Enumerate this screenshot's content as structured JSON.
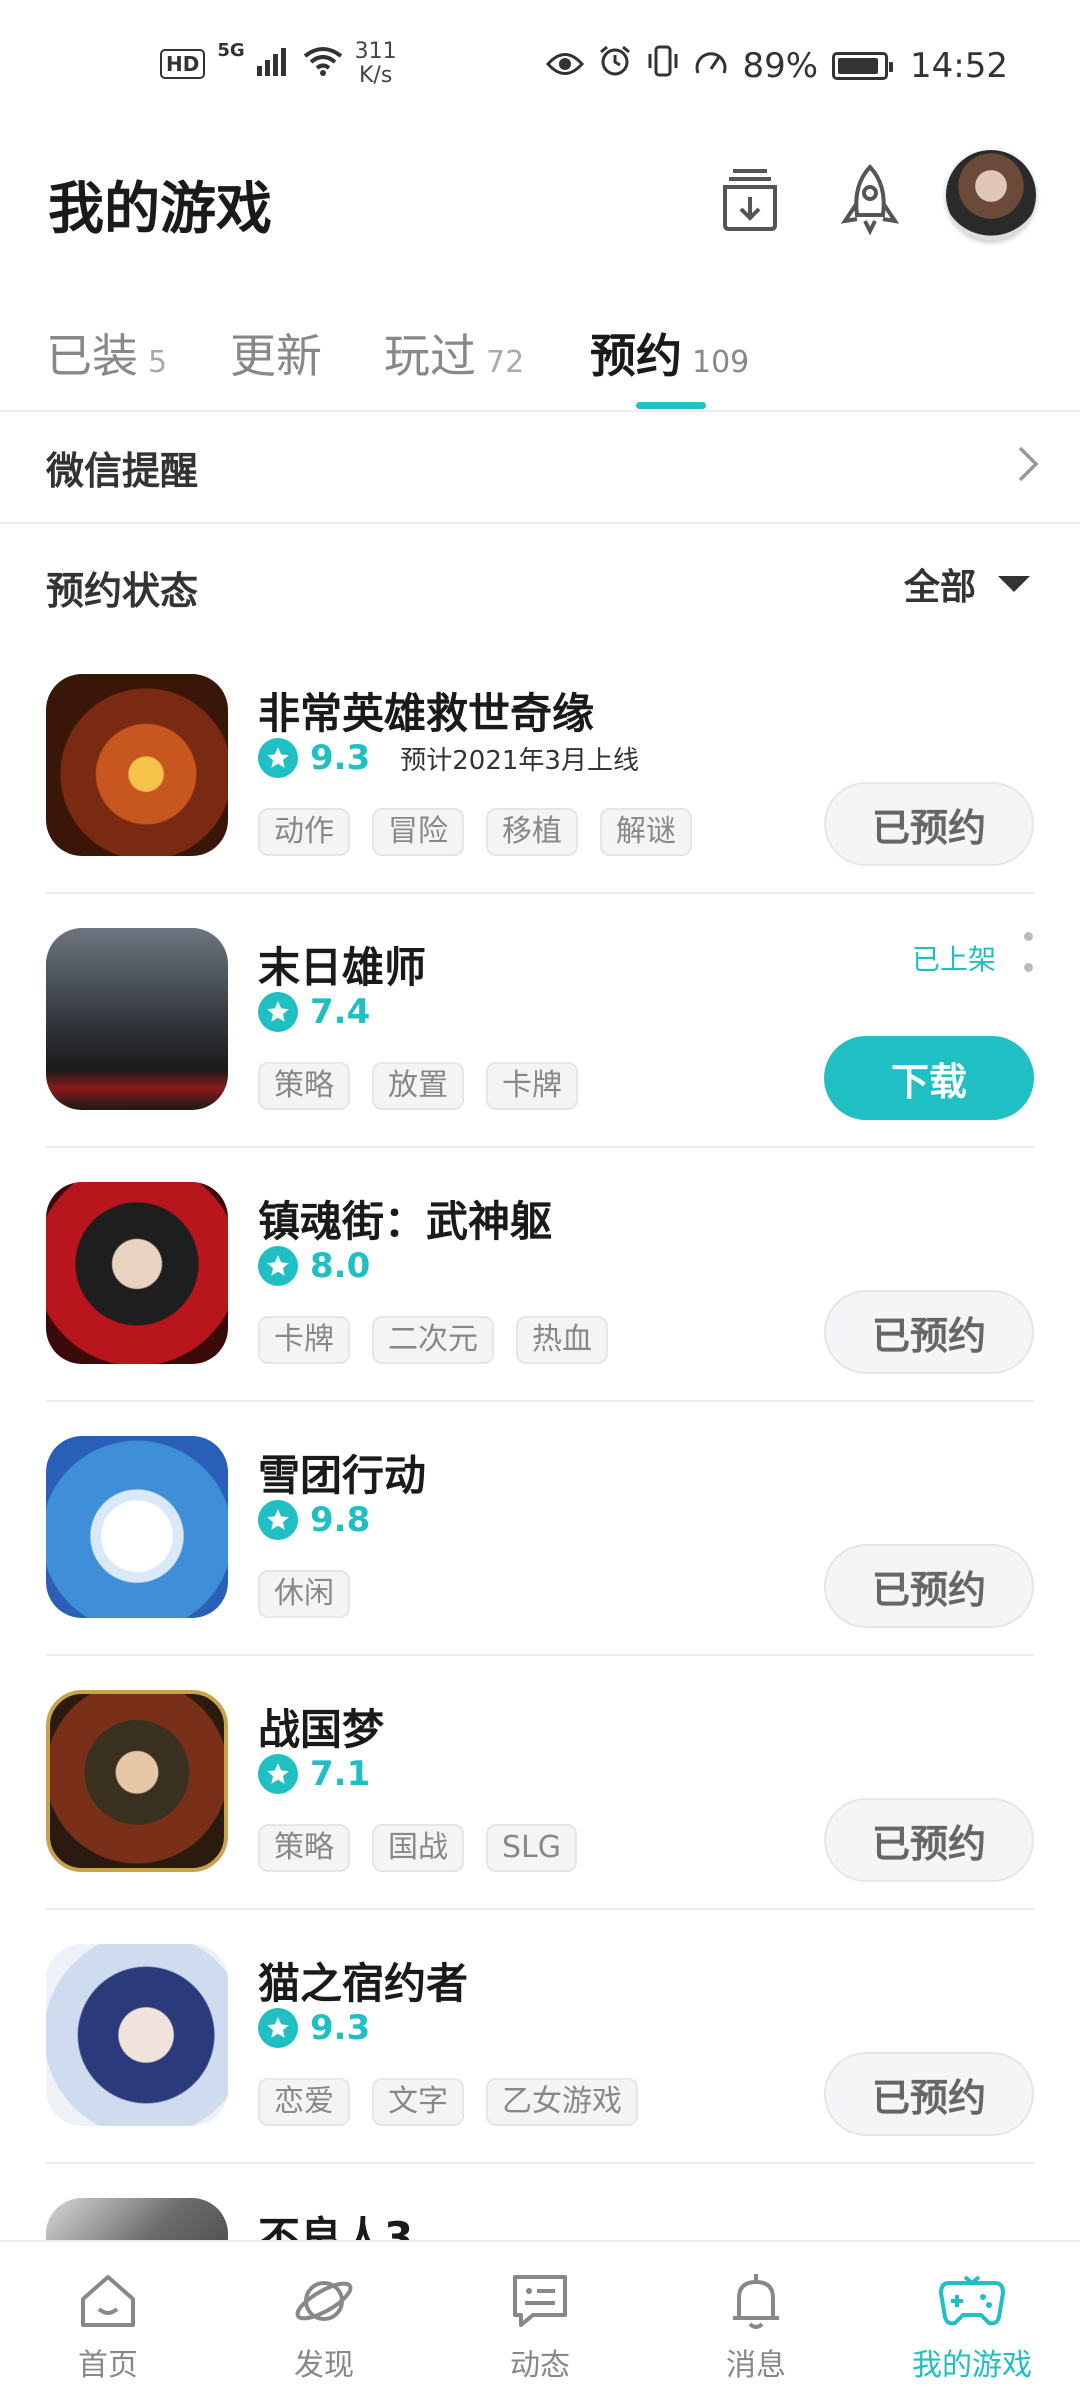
{
  "status_bar": {
    "hd": "HD",
    "network": "5G",
    "speed_value": "311",
    "speed_unit": "K/s",
    "battery": "89%",
    "time": "14:52"
  },
  "header": {
    "title": "我的游戏",
    "icons": [
      "download-box-icon",
      "rocket-icon",
      "avatar"
    ]
  },
  "tabs": [
    {
      "label": "已装",
      "count": "5"
    },
    {
      "label": "更新",
      "count": ""
    },
    {
      "label": "玩过",
      "count": "72"
    },
    {
      "label": "预约",
      "count": "109",
      "active": true
    }
  ],
  "wechat_reminder": {
    "label": "微信提醒"
  },
  "reservation_status": {
    "label": "预约状态",
    "filter": "全部"
  },
  "games": [
    {
      "name": "非常英雄救世奇缘",
      "rating": "9.3",
      "release": "预计2021年3月上线",
      "tags": [
        "动作",
        "冒险",
        "移植",
        "解谜"
      ],
      "button": "已预约"
    },
    {
      "name": "末日雄师",
      "rating": "7.4",
      "release": "",
      "tags": [
        "策略",
        "放置",
        "卡牌"
      ],
      "button": "下载",
      "launched": "已上架"
    },
    {
      "name": "镇魂街：武神躯",
      "rating": "8.0",
      "release": "",
      "tags": [
        "卡牌",
        "二次元",
        "热血"
      ],
      "button": "已预约"
    },
    {
      "name": "雪团行动",
      "rating": "9.8",
      "release": "",
      "tags": [
        "休闲"
      ],
      "button": "已预约"
    },
    {
      "name": "战国梦",
      "rating": "7.1",
      "release": "",
      "tags": [
        "策略",
        "国战",
        "SLG"
      ],
      "button": "已预约"
    },
    {
      "name": "猫之宿约者",
      "rating": "9.3",
      "release": "",
      "tags": [
        "恋爱",
        "文字",
        "乙女游戏"
      ],
      "button": "已预约"
    },
    {
      "name": "不良人3",
      "rating": "",
      "release": "",
      "tags": [],
      "button": ""
    }
  ],
  "bottom_nav": [
    {
      "label": "首页",
      "icon": "home-icon"
    },
    {
      "label": "发现",
      "icon": "planet-icon"
    },
    {
      "label": "动态",
      "icon": "chat-icon"
    },
    {
      "label": "消息",
      "icon": "bell-icon"
    },
    {
      "label": "我的游戏",
      "icon": "gamepad-icon",
      "active": true
    }
  ],
  "colors": {
    "accent": "#1fbfc4",
    "text": "#1a1a1a",
    "muted": "#888888"
  }
}
